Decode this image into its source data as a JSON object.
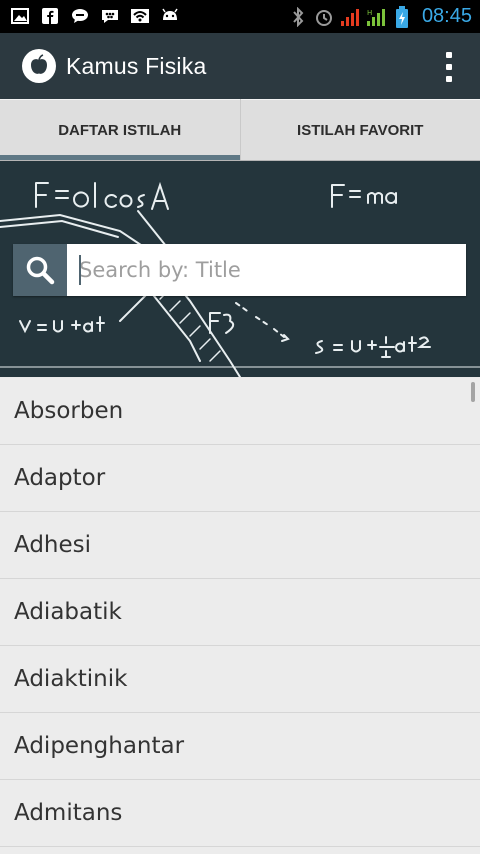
{
  "status_bar": {
    "time": "08:45",
    "left_icons": [
      "image-icon",
      "facebook-icon",
      "messenger-icon",
      "bbm-icon",
      "wifi-icon",
      "android-icon"
    ],
    "right_icons": [
      "bluetooth-icon",
      "alarm-icon",
      "signal-icon",
      "data-signal-icon",
      "battery-icon"
    ]
  },
  "action_bar": {
    "title": "Kamus Fisika",
    "logo_icon": "apple-logo-icon",
    "menu_icon": "overflow-menu-icon"
  },
  "tabs": [
    {
      "label": "DAFTAR ISTILAH",
      "active": true
    },
    {
      "label": "ISTILAH FAVORIT",
      "active": false
    }
  ],
  "search": {
    "placeholder": "Search by: Title",
    "value": ""
  },
  "terms": [
    "Absorben",
    "Adaptor",
    "Adhesi",
    "Adiabatik",
    "Adiaktinik",
    "Adipenghantar",
    "Admitans"
  ],
  "colors": {
    "action_bar": "#2c3940",
    "tab_indicator": "#5f7885",
    "search_button": "#4f6470",
    "time": "#3aa9e6"
  }
}
